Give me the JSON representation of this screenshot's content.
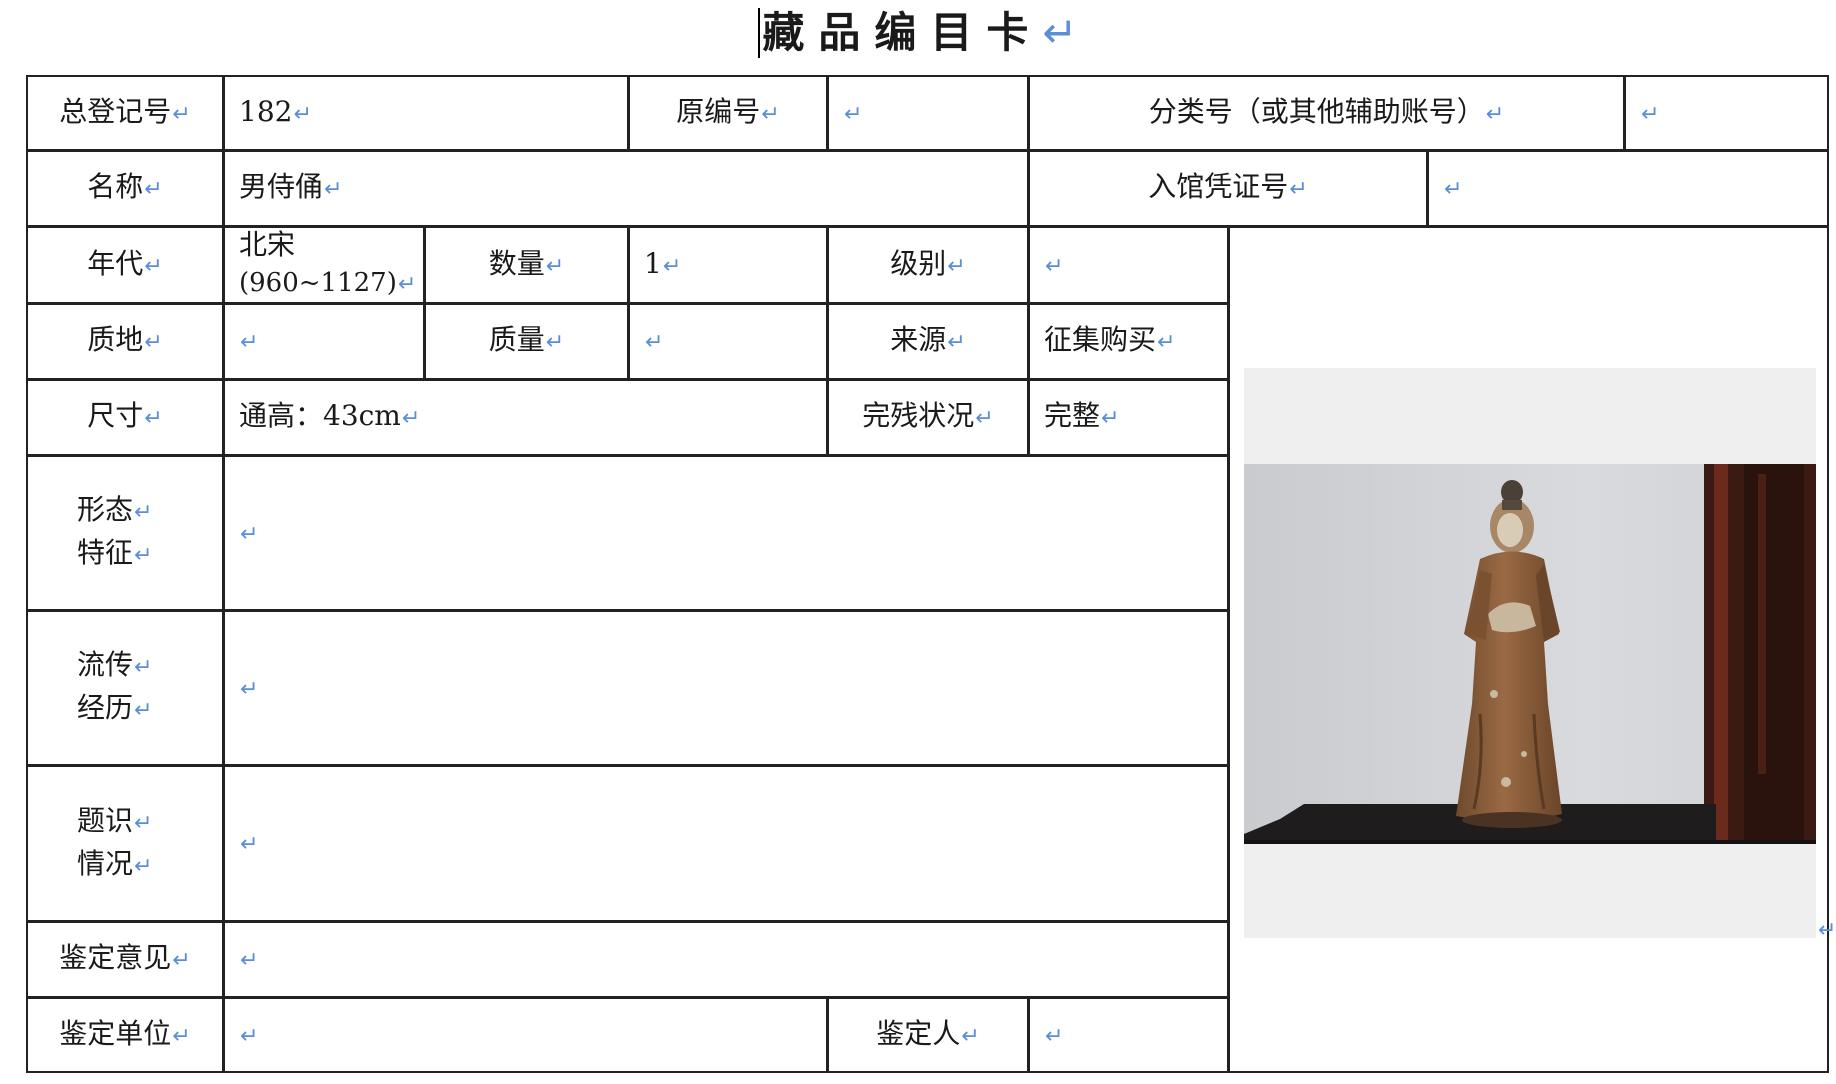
{
  "title": "藏品编目卡",
  "labels": {
    "reg_no": "总登记号",
    "orig_no": "原编号",
    "class_no": "分类号（或其他辅助账号）",
    "name": "名称",
    "entry_no": "入馆凭证号",
    "era": "年代",
    "quantity": "数量",
    "grade": "级别",
    "material": "质地",
    "weight": "质量",
    "source": "来源",
    "size": "尺寸",
    "condition": "完残状况",
    "form_1": "形态",
    "form_2": "特征",
    "history_1": "流传",
    "history_2": "经历",
    "inscr_1": "题识",
    "inscr_2": "情况",
    "opinion": "鉴定意见",
    "unit": "鉴定单位",
    "appraiser": "鉴定人"
  },
  "values": {
    "reg_no": "182",
    "orig_no": "",
    "class_no": "",
    "name": "男侍俑",
    "entry_no": "",
    "era_line1": "北宋",
    "era_line2": "(960~1127)",
    "quantity": "1",
    "grade": "",
    "material": "",
    "weight": "",
    "source": "征集购买",
    "size": "通高：43cm",
    "condition": "完整",
    "form": "",
    "history": "",
    "inscription": "",
    "opinion": "",
    "unit": "",
    "appraiser": ""
  },
  "colors": {
    "return_mark": "#5b8ed8",
    "border": "#222222"
  }
}
